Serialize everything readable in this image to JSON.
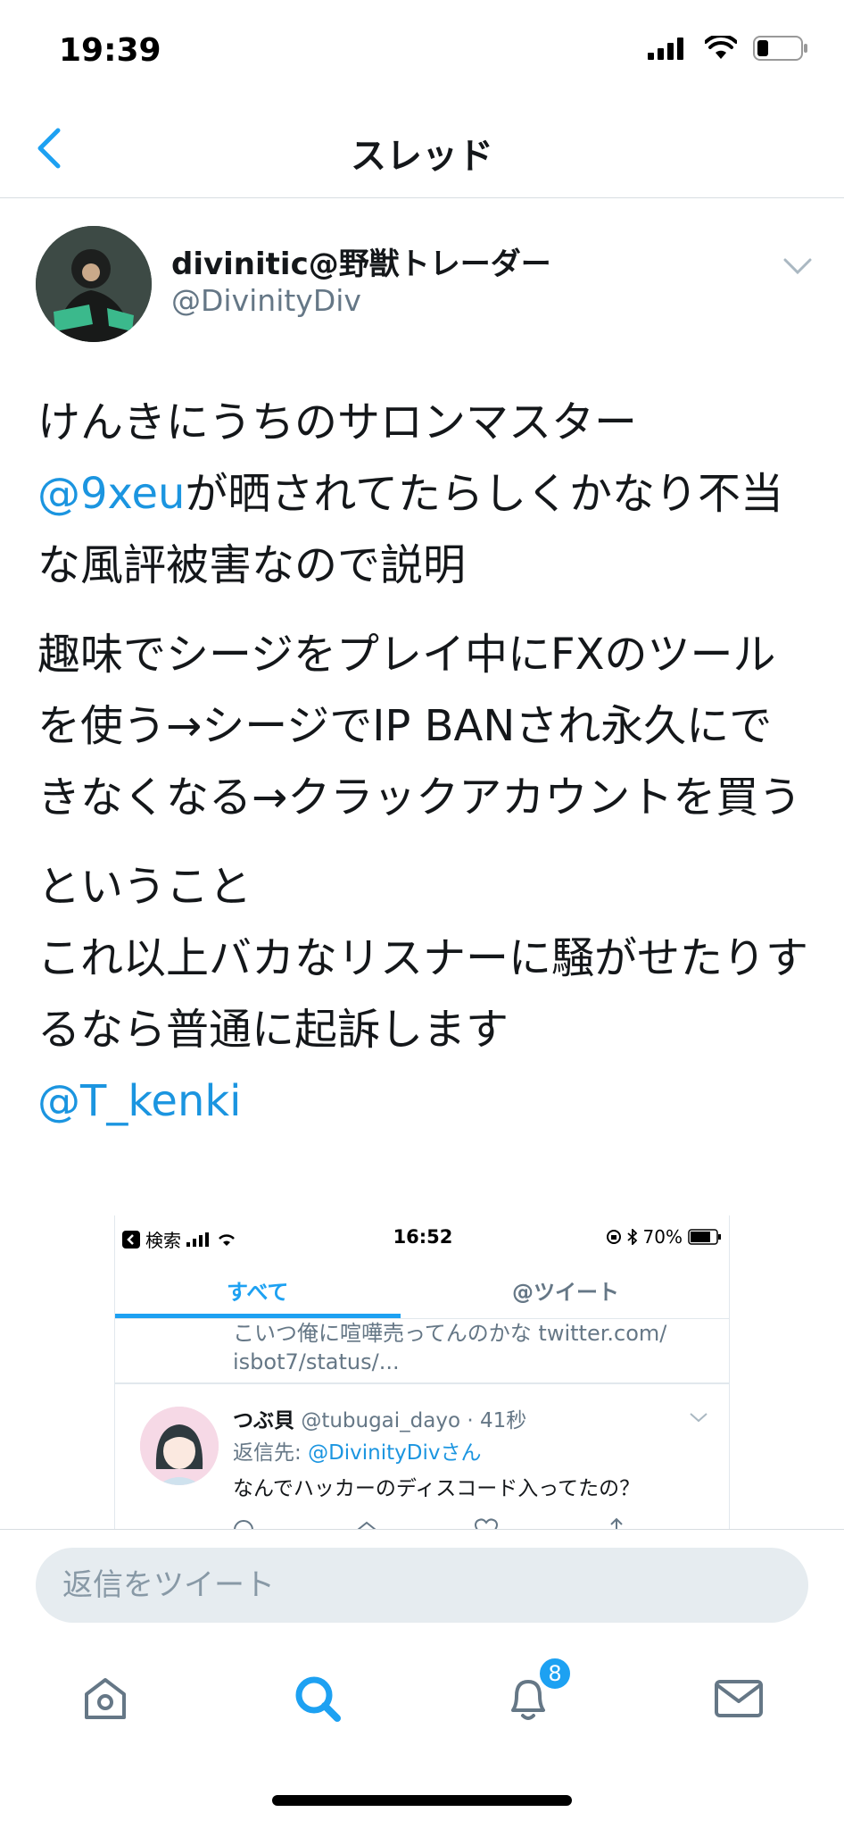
{
  "status_bar": {
    "time": "19:39"
  },
  "nav": {
    "title": "スレッド"
  },
  "tweet": {
    "user_name": "divinitic@野獣トレーダー",
    "handle": "@DivinityDiv",
    "p1_a": "けんきにうちのサロンマスター",
    "p1_mention": "@9xeu",
    "p1_b": "が晒されてたらしくかなり不当な風評被害なので説明",
    "p2": "趣味でシージをプレイ中にFXのツールを使う→シージでIP BANされ永久にできなくなる→クラックアカウントを買う",
    "p3_line1": "ということ",
    "p3_line2": "これ以上バカなリスナーに騒がせたりするなら普通に起訴します",
    "p3_mention": "@T_kenki"
  },
  "embed": {
    "back_label": "検索",
    "time": "16:52",
    "battery": "70%",
    "tab_all": "すべて",
    "tab_tweets": "@ツイート",
    "prev_tweet": "こいつ俺に喧嘩売ってんのかな twitter.com/ isbot7/status/...",
    "reply_name": "つぶ貝",
    "reply_handle_time": "@tubugai_dayo · 41秒",
    "reply_to_prefix": "返信先:",
    "reply_to_user": "@DivinityDivさん",
    "reply_text": "なんでハッカーのディスコード入ってたの？"
  },
  "reply": {
    "placeholder": "返信をツイート"
  },
  "tabbar": {
    "notifications_badge": "8"
  },
  "colors": {
    "accent": "#1da1f2",
    "mention": "#1b95e0",
    "muted": "#657786"
  }
}
